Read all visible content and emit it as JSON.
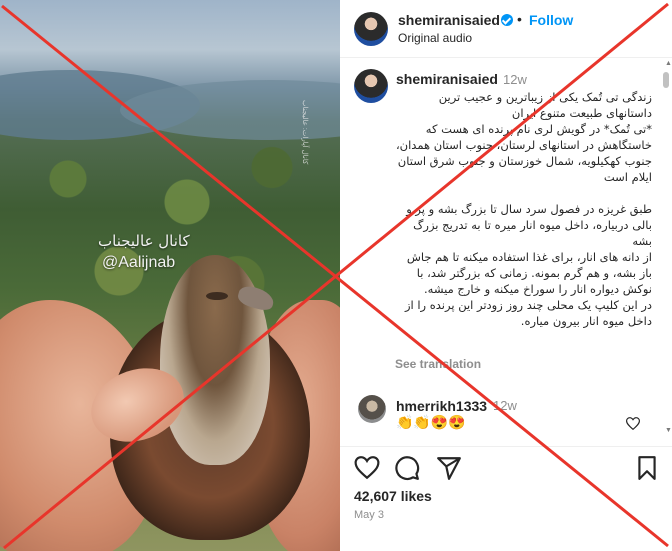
{
  "media": {
    "watermark_arabic": "كانال عاليجناب",
    "watermark_handle": "@Aalijnab",
    "side_credit": "کانال آپارات: عالیجناب"
  },
  "header": {
    "username": "shemiranisaied",
    "follow_label": "Follow",
    "separator": "•",
    "subtitle": "Original audio"
  },
  "caption": {
    "username": "shemiranisaied",
    "time": "12w",
    "text": "زندگی تی تُمک یکی از زیباترین و عجیب ترین داستانهای طبیعت متنوع ایران\n*تی تُمک* در گویش لری نام پرنده ای هست که خاستگاهش در استانهای لرستان، جنوب استان همدان، جنوب کهکیلویه، شمال خوزستان و جنوب شرق استان ایلام است\n\nطبق غریزه در فصول سرد سال تا بزرگ بشه و پر و بالی دربیاره، داخل میوه انار میره تا به تدریج بزرگ بشه\nاز دانه های انار، برای غذا استفاده میکنه تا هم جاش باز بشه، و هم گرم بمونه. زمانی که بزرگتر شد، با نوکش دیواره انار را سوراخ میکنه و خارج میشه.\nدر این کلیپ یک محلی چند روز زودتر این پرنده را از داخل میوه انار بیرون میاره.",
    "see_translation": "See translation"
  },
  "comment": {
    "username": "hmerrikh1333",
    "time": "12w",
    "text": "👏👏😍😍"
  },
  "actions": {
    "likes": "42,607 likes",
    "date": "May 3"
  },
  "icons": {
    "like": "heart-icon",
    "comment": "comment-icon",
    "share": "share-icon",
    "save": "bookmark-icon"
  },
  "colors": {
    "accent_blue": "#0095f6",
    "overlay_red": "#e8352b",
    "muted_text": "#8e8e8e"
  }
}
